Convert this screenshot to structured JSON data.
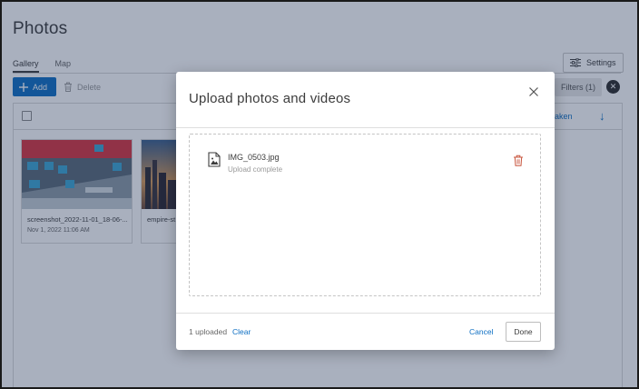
{
  "page": {
    "title": "Photos",
    "tabs": [
      {
        "label": "Gallery",
        "active": true
      },
      {
        "label": "Map",
        "active": false
      }
    ],
    "settings_label": "Settings",
    "add_label": "Add",
    "delete_label": "Delete",
    "filters_label": "Filters (1)",
    "sort_label": "aken"
  },
  "photos": [
    {
      "name": "screenshot_2022-11-01_18-06-...",
      "date": "Nov 1, 2022 11:06 AM"
    },
    {
      "name": "empire-st",
      "date": ""
    }
  ],
  "modal": {
    "title": "Upload photos and videos",
    "files": [
      {
        "name": "IMG_0503.jpg",
        "status": "Upload complete"
      }
    ],
    "uploaded_count": "1 uploaded",
    "clear_label": "Clear",
    "cancel_label": "Cancel",
    "done_label": "Done"
  },
  "colors": {
    "accent": "#0e6fc3",
    "delete_icon": "#c8553d",
    "overlay": "#1e3054"
  },
  "icons": {
    "settings": "sliders-icon",
    "add": "plus-icon",
    "delete": "trash-icon",
    "filters_clear": "close-circle-icon",
    "sort": "arrow-down-icon",
    "modal_close": "close-icon",
    "file": "image-file-icon",
    "file_delete": "trash-icon"
  }
}
